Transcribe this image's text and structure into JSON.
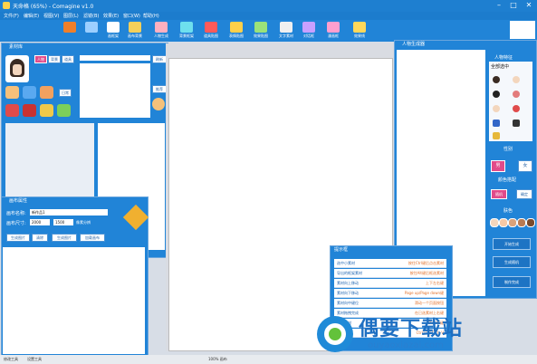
{
  "title": "天命格 (65%) - Comagine v1.0",
  "menu": [
    "文件(F)",
    "编辑(E)",
    "视图(V)",
    "图层(L)",
    "滤镜(B)",
    "效果(E)",
    "窗口(W)",
    "帮助(H)"
  ],
  "toolbar": [
    {
      "label": "",
      "color": "#f07f2a"
    },
    {
      "label": "",
      "color": "#9ccfff"
    },
    {
      "label": "画框架",
      "color": "#ffffff"
    },
    {
      "label": "画布背景",
      "color": "#f6d05a"
    },
    {
      "label": "人物生成",
      "color": "#ffb0c0"
    },
    {
      "label": "背景框架",
      "color": "#6ee0ee"
    },
    {
      "label": "道具贴图",
      "color": "#ff5a5a"
    },
    {
      "label": "表情贴图",
      "color": "#ffd04a"
    },
    {
      "label": "效果贴图",
      "color": "#9be27a"
    },
    {
      "label": "文字素材",
      "color": "#f0f0f0"
    },
    {
      "label": "对话框",
      "color": "#c8a0ff"
    },
    {
      "label": "漫画框",
      "color": "#ff9fcf"
    },
    {
      "label": "效果线",
      "color": "#ffd85a"
    },
    {
      "label": "",
      "color": "#5ac8ff"
    }
  ],
  "login": "注册",
  "material": {
    "title": "素材库",
    "tags": [
      "人物",
      "背景",
      "道具"
    ],
    "side_btns": [
      "刷新",
      "推荐"
    ],
    "day_btn": "日常"
  },
  "canvas_props": {
    "title": "画布属性",
    "name_label": "画布名称:",
    "name_value": "新作品1",
    "size_label": "画布尺寸:",
    "width": "2000",
    "height": "1500",
    "pixel_label": "像素分辨",
    "buttons": [
      "生成图片",
      "清除",
      "生成图片",
      "加载画布"
    ]
  },
  "char_gen": {
    "title": "人物生成器",
    "sec_feature": "人物特征",
    "select_all": "全部选中",
    "sec_gender": "性别",
    "gender": [
      "男",
      "女"
    ],
    "sec_color": "颜色搭配",
    "color_btns": [
      "随机",
      "确定"
    ],
    "sec_skin": "肤色",
    "skin_colors": [
      "#f3d6bd",
      "#f5c9a6",
      "#d9a27a",
      "#b87a52",
      "#7a4a2c"
    ],
    "actions": [
      "开始生成",
      "生成随机",
      "制作完成"
    ]
  },
  "tips": {
    "title": "提示框",
    "rows": [
      {
        "left": "选中小素材",
        "right": "按住Ctrl键后点击素材"
      },
      {
        "left": "导出的框架素材",
        "right": "按住Alt键后框选素材"
      },
      {
        "left": "素材向上移动",
        "right": "上下左右键"
      },
      {
        "left": "素材向下移动",
        "right": "Page up/Page down键"
      },
      {
        "left": "素材向中键位",
        "right": "滑动一个页面按钮"
      },
      {
        "left": "素材拖拽完成",
        "right": "在已选素材上右键"
      },
      {
        "left": "删除素材",
        "right": "Delete键"
      },
      {
        "left": "复制素材",
        "right": "Ctrl+C / Ctrl+V"
      }
    ]
  },
  "status": [
    "修改工具",
    "设置工具",
    "100% 画布"
  ],
  "watermark": {
    "big": "偶要下载站",
    "small": "ouyaoxiazai.com"
  }
}
